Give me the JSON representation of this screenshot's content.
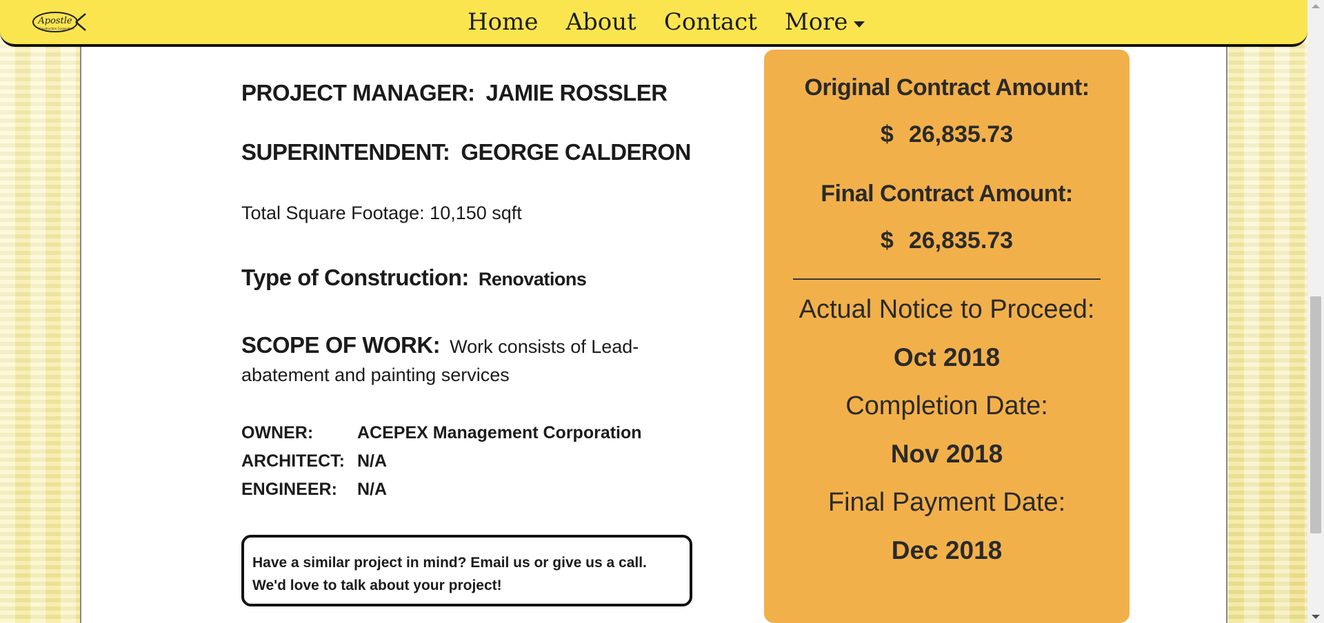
{
  "nav": {
    "logo_text": "Apostle",
    "links": [
      "Home",
      "About",
      "Contact",
      "More"
    ]
  },
  "project": {
    "manager_label": "PROJECT MANAGER:",
    "manager_value": "JAMIE ROSSLER",
    "super_label": "SUPERINTENDENT:",
    "super_value": "GEORGE CALDERON",
    "sqft": "Total Square Footage: 10,150 sqft",
    "type_label": "Type of Construction:",
    "type_value": "Renovations",
    "scope_label": "SCOPE OF WORK:",
    "scope_value": "Work consists of Lead-abatement and painting services",
    "owner_label": "OWNER:",
    "owner_value": "ACEPEX Management Corporation",
    "architect_label": "ARCHITECT:",
    "architect_value": "N/A",
    "engineer_label": "ENGINEER:",
    "engineer_value": "N/A",
    "cta": "Have a similar project in mind? Email us or give us a call. We'd love to talk about your project!"
  },
  "summary": {
    "original_label": "Original Contract Amount:",
    "original_currency": "$",
    "original_amount": "26,835.73",
    "final_label": "Final Contract Amount:",
    "final_currency": "$",
    "final_amount": "26,835.73",
    "ntp_label": "Actual Notice to Proceed:",
    "ntp_value": "Oct 2018",
    "completion_label": "Completion Date:",
    "completion_value": "Nov 2018",
    "payment_label": "Final Payment Date:",
    "payment_value": "Dec 2018"
  },
  "colors": {
    "nav_bg": "#fbe54f",
    "summary_bg": "#f2b04a"
  }
}
